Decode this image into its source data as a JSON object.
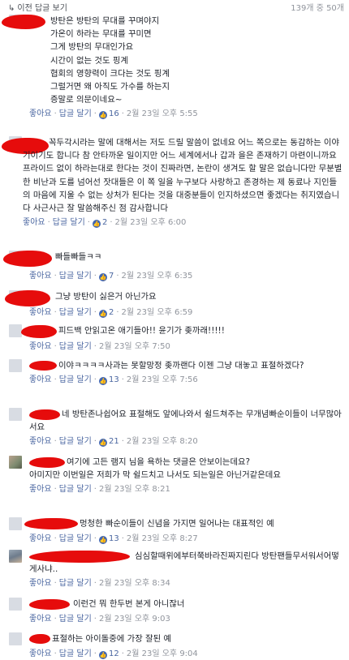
{
  "header": {
    "prev_replies": "이전 답글 보기",
    "count": "139개 중 50개"
  },
  "actions": {
    "like": "좋아요",
    "reply": "답글 달기"
  },
  "comments": [
    {
      "text": "방탄은 방탄의 무대를 꾸며야지\n가온이 하라는 무대를 꾸미면\n그게 방탄의 무대인가요\n시간이 없는 것도 핑계\n협회의 영향력이 크다는 것도 핑계\n그럴거면 왜 아직도 가수를 하는지\n증말로 의문이네요~",
      "likes": "16",
      "time": "2월 23일 오후 5:55"
    },
    {
      "text": "꼭두각시라는 말에 대해서는 저도 드릴 말씀이 없네요 어느 쪽으로는 동감하는 이야기이기도 합니다 참 안타까운 일이지만 어느 세계에서나 갑과 을은 존재하기 마련이니까요 프라이드 없이 하라는대로 한다는 것이 진짜라면, 논란이 생겨도 할 말은 없습니다만 무분별한 비난과 도를 넘어선 잣대들은 이 쪽 일을 누구보다 사랑하고 존경하는 제 동료나 지인들의 마음에 지울 수 없는 상처가 된다는 것을 대중분들이 인지하셨으면 좋겠다는 취지였습니다 사근사근 잘 말씀해주신 점 감사합니다",
      "likes": "2",
      "time": "2월 23일 오후 6:00"
    },
    {
      "text": "빠들빠들ㅋㅋ",
      "likes": "7",
      "time": "2월 23일 오후 6:35"
    },
    {
      "text": "그냥 방탄이 싫은거 아닌가요",
      "likes": "2",
      "time": "2월 23일 오후 6:59"
    },
    {
      "text": "피드백 안읽고온 애기들아!! 윤기가 좆까래!!!!!",
      "likes": "",
      "time": "2월 23일 오후 7:50"
    },
    {
      "text": "이야ㅋㅋㅋㅋ사과는 못할망정 좆까랜다 이젠 그냥 대놓고 표절하겠다?",
      "likes": "13",
      "time": "2월 23일 오후 7:56"
    },
    {
      "text": "네 방탄존나쉽어요 표절해도 앞에나와서 쉴드쳐주는 무개념빠순이들이 너무많아서요",
      "likes": "21",
      "time": "2월 23일 오후 8:20"
    },
    {
      "text": "여기에 고든 램지 님을 욕하는 댓글은 안보이는데요?\n아미지만 이번일은 저희가 막 쉴드치고 나서도 되는일은 아닌거같은데요",
      "likes": "",
      "time": "2월 23일 오후 8:21"
    },
    {
      "text": "멍청한 빠순이들이 신념을 가지면 일어나는 대표적인 예",
      "likes": "13",
      "time": "2월 23일 오후 8:27"
    },
    {
      "text": "심심할때위에부터쭉바라진짜지린다 방탄팬들무서워서어떻게사냐..",
      "likes": "",
      "time": "2월 23일 오후 8:34"
    },
    {
      "text": "이런건 뭐 한두번 본게 아니잖너",
      "likes": "",
      "time": "2월 23일 오후 9:03"
    },
    {
      "text": "표절하는 아이돌중에 가장 잘된 예",
      "likes": "12",
      "time": "2월 23일 오후 9:04"
    }
  ]
}
